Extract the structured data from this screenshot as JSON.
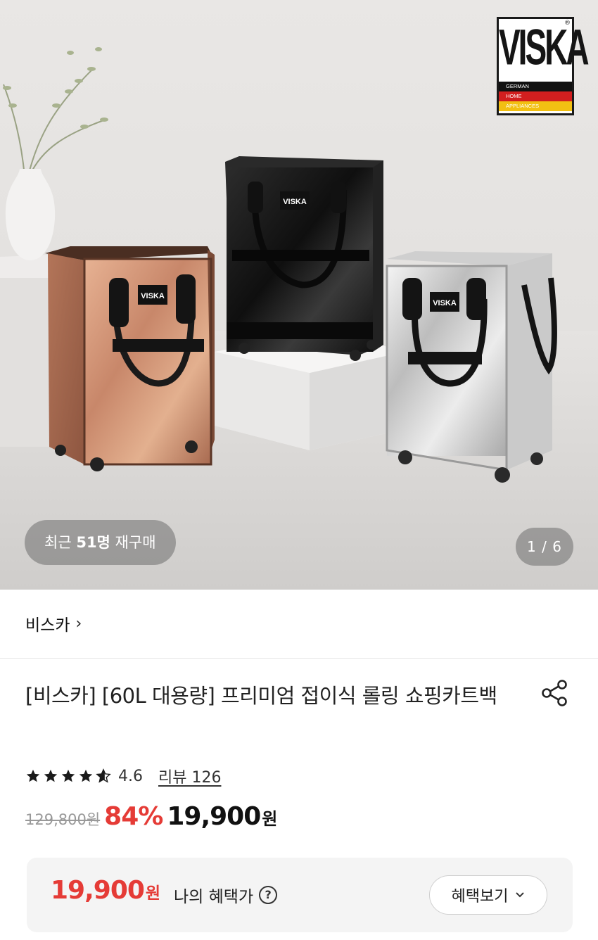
{
  "hero": {
    "logo": {
      "brand": "VISKA",
      "registered": "®",
      "line1": "GERMAN",
      "line2": "HOME",
      "line3": "APPLIANCES"
    },
    "bag_label": "VISKA",
    "repurchase": {
      "prefix": "최근 ",
      "count": "51명",
      "suffix": " 재구매"
    },
    "pager": "1 / 6"
  },
  "store": {
    "name": "비스카",
    "chevron": "›"
  },
  "product": {
    "title": "[비스카] [60L 대용량] 프리미엄 접이식 롤링 쇼핑카트백",
    "rating": 4.6,
    "rating_text": "4.6",
    "review_link": "리뷰 126",
    "original_price": "129,800원",
    "discount": "84%",
    "price": "19,900",
    "price_unit": "원"
  },
  "benefit": {
    "price": "19,900",
    "price_unit": "원",
    "label": "나의 혜택가",
    "help": "?",
    "button": "혜택보기",
    "button_icon": "chevron-down-icon"
  },
  "colors": {
    "accent_red": "#e53b36",
    "rose_gold": "#c98b6a",
    "black_bag": "#1b1b1b",
    "silver_bag": "#dcdcdc"
  }
}
